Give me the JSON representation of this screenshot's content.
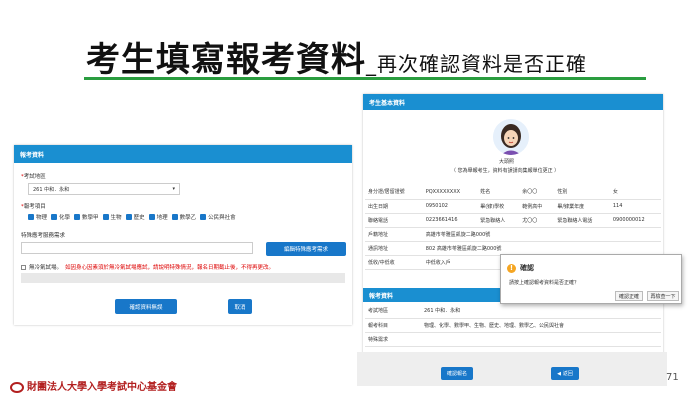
{
  "slide": {
    "title": "考生填寫報考資料",
    "subtitle": "_再次確認資料是否正確",
    "page_number": "71",
    "footer_org": "財團法人大學入學考試中心基金會",
    "accent_color": "#2a9d3f"
  },
  "left_panel": {
    "header": "報考資料",
    "exam_area_label": "考試地區",
    "exam_area_value": "261 中和．永和",
    "subjects_label": "報考項目",
    "subjects": [
      "物理",
      "化學",
      "數學甲",
      "生物",
      "歷史",
      "地理",
      "數學乙",
      "公民與社會"
    ],
    "special_label": "特殊應考服務需求",
    "special_button": "編輯特殊應考需求",
    "no_ac_label": "無冷氣試場。",
    "no_ac_note": "如因身心因素須於無冷氣試場應試，請說明特殊情況，報名日期截止後，不得再更改。",
    "confirm_button": "確認資料無誤",
    "cancel_button": "取消"
  },
  "right_panel": {
    "header": "考生基本資料",
    "name": "大頭照",
    "photo_note": "（ 您為舉報考生，資料有誤請向集報單位更正 ）",
    "rows": [
      [
        "身分證/居留證號",
        "PQXXXXXXXX",
        "姓名",
        "余〇〇",
        "性別",
        "女"
      ],
      [
        "出生日期",
        "0950102",
        "畢(肄)學校",
        "範例高中",
        "畢/肄業年度",
        "114"
      ],
      [
        "聯絡電話",
        "0223661416",
        "緊急聯絡人",
        "尤〇〇",
        "緊急聯絡人電話",
        "0900000012"
      ]
    ],
    "address_rows": [
      [
        "戶籍地址",
        "高雄市苓雅區凱旋二路000號"
      ],
      [
        "通訊地址",
        "802 高雄市苓雅區凱旋二路000號"
      ],
      [
        "低收/中低收",
        "中低收入戶"
      ]
    ],
    "exam_header": "報考資料",
    "exam_rows": [
      [
        "考試地區",
        "261 中和．永和"
      ],
      [
        "報考科目",
        "物理、化學、數學甲、生物、歷史、地理、數學乙、公民與社會"
      ],
      [
        "特殊需求",
        ""
      ]
    ],
    "confirm_button": "確認報名",
    "back_button": "返回"
  },
  "dialog": {
    "title": "確認",
    "message": "請按上確認報考資料是否正確？",
    "ok_button": "確認正確",
    "prev_button": "再檢查一下"
  }
}
